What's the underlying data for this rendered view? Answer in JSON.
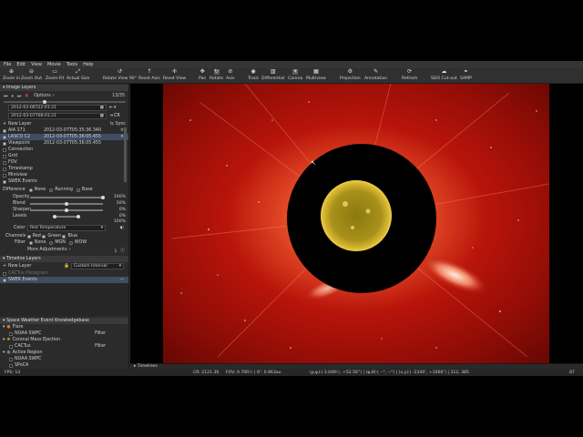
{
  "menu": [
    "File",
    "Edit",
    "View",
    "Movie",
    "Tools",
    "Help"
  ],
  "toolbar": [
    {
      "label": "Zoom in",
      "icon": "zoom-in-icon"
    },
    {
      "label": "Zoom Out",
      "icon": "zoom-out-icon"
    },
    {
      "label": "Zoom-Fit",
      "icon": "zoom-fit-icon"
    },
    {
      "label": "Actual Size",
      "icon": "actual-size-icon"
    },
    {
      "label": "Rotate View 90°",
      "icon": "rotate-view-icon"
    },
    {
      "label": "Reset Axis",
      "icon": "reset-axis-icon"
    },
    {
      "label": "Reset View",
      "icon": "reset-view-icon"
    },
    {
      "label": "Pan",
      "icon": "pan-icon"
    },
    {
      "label": "Rotate",
      "icon": "rotate-icon"
    },
    {
      "label": "Axis",
      "icon": "axis-icon"
    },
    {
      "label": "Track",
      "icon": "track-icon"
    },
    {
      "label": "Differential",
      "icon": "differential-icon"
    },
    {
      "label": "Corona",
      "icon": "corona-icon"
    },
    {
      "label": "Multiview",
      "icon": "multiview-icon"
    },
    {
      "label": "Projection",
      "icon": "projection-icon"
    },
    {
      "label": "Annotation",
      "icon": "annotation-icon"
    },
    {
      "label": "Refresh",
      "icon": "refresh-icon"
    },
    {
      "label": "SDO Cut-out",
      "icon": "sdo-cutout-icon"
    },
    {
      "label": "SAMP",
      "icon": "samp-icon"
    }
  ],
  "image_layers": {
    "header": "Image Layers",
    "options_label": "Options",
    "frame_counter": "13/35",
    "start_time": "2012-03-06T22:01:21",
    "end_time": "2012-03-07T08:01:21",
    "new_layer": "New Layer",
    "sync_label": "Sync",
    "layers": [
      {
        "name": "AIA 171",
        "time": "2012-03-07T05:35:36.340",
        "checked": true
      },
      {
        "name": "LASCO C2",
        "time": "2012-03-07T05:36:05.455",
        "checked": true,
        "selected": true
      },
      {
        "name": "Viewpoint",
        "time": "2012-03-07T05:36:05.455",
        "checked": true
      },
      {
        "name": "Connection",
        "time": "",
        "checked": false
      },
      {
        "name": "Grid",
        "time": "",
        "checked": false
      },
      {
        "name": "FOV",
        "time": "",
        "checked": false
      },
      {
        "name": "Timestamp",
        "time": "",
        "checked": false
      },
      {
        "name": "Miniview",
        "time": "",
        "checked": false
      },
      {
        "name": "SWEK Events",
        "time": "",
        "checked": true
      }
    ]
  },
  "adjust": {
    "difference_label": "Difference",
    "difference_options": [
      "None",
      "Running",
      "Base"
    ],
    "opacity_label": "Opacity",
    "opacity_value": "100%",
    "blend_label": "Blend",
    "blend_value": "50%",
    "sharpen_label": "Sharpen",
    "sharpen_value": "0%",
    "levels_label": "Levels",
    "levels_value_a": "0%",
    "levels_value_b": "100%",
    "color_label": "Color",
    "color_value": "Red Temperature",
    "channels_label": "Channels",
    "channels": [
      "Red",
      "Green",
      "Blue"
    ],
    "filter_label": "Filter",
    "filter_options": [
      "None",
      "MGN",
      "WOW"
    ],
    "more_adjustments": "More Adjustments"
  },
  "timeline_layers": {
    "header": "Timeline Layers",
    "new_layer": "New Layer",
    "interval_value": "Custom Interval",
    "items": [
      "CACTus Histogram",
      "SWEK Events"
    ]
  },
  "swek": {
    "header": "Space Weather Event Knowledgebase",
    "groups": [
      {
        "name": "Flare",
        "sources": [
          "NOAA SWPC"
        ],
        "filter": "Filter"
      },
      {
        "name": "Coronal Mass Ejection",
        "sources": [
          "CACTus"
        ],
        "filter": "Filter"
      },
      {
        "name": "Active Region",
        "sources": [
          "NOAA SWPC",
          "SPoCA"
        ],
        "filter": ""
      }
    ]
  },
  "timelines_bar": "Timelines",
  "status": {
    "fps": "FPS: 14",
    "cr": "CR: 2121.36",
    "fov": "FOV:  0.70R☉ | 8″: 0.963au",
    "coords": "(ρ,ψ):(  3.049☉, +52.56°) | (φ,θ):(     --°,      --°) | (x,y):( -2340″, +1060″) | 312, 385",
    "zoom": "87"
  },
  "colors": {
    "bg": "#2b2b2b",
    "selection": "#3f4d63",
    "corona": "#b01208",
    "sun": "#c8a81e"
  }
}
